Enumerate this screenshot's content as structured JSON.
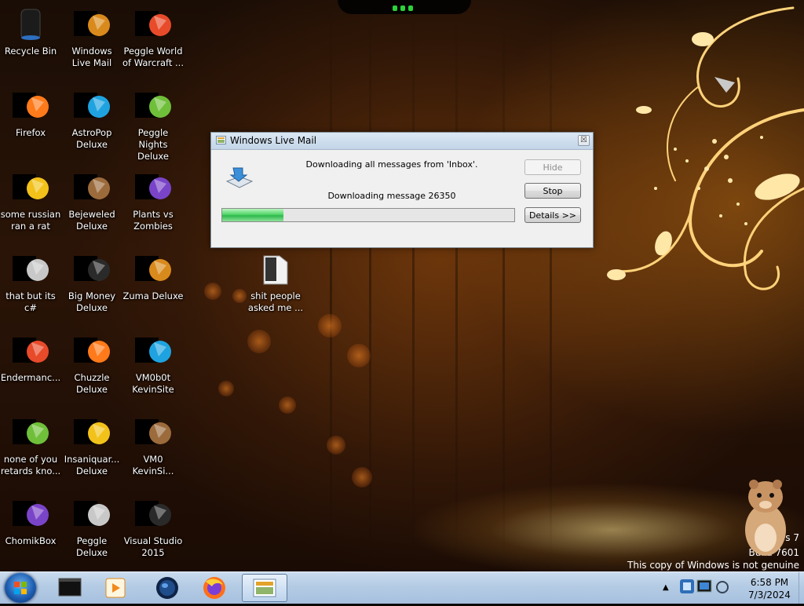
{
  "desktop_icons": [
    {
      "label": "Recycle Bin",
      "icon": "recycle-bin-icon"
    },
    {
      "label": "Windows Live Mail",
      "icon": "mail-icon"
    },
    {
      "label": "Peggle World of Warcraft ...",
      "icon": "peggle-icon"
    },
    {
      "label": "Firefox",
      "icon": "firefox-icon"
    },
    {
      "label": "AstroPop Deluxe",
      "icon": "game-icon"
    },
    {
      "label": "Peggle Nights Deluxe",
      "icon": "peggle-icon"
    },
    {
      "label": "some russian ran a rat",
      "icon": "app-icon"
    },
    {
      "label": "Bejeweled Deluxe",
      "icon": "gem-icon"
    },
    {
      "label": "Plants vs Zombies",
      "icon": "plant-icon"
    },
    {
      "label": "that but its c#",
      "icon": "app-icon"
    },
    {
      "label": "Big Money Deluxe",
      "icon": "game-icon"
    },
    {
      "label": "Zuma Deluxe",
      "icon": "game-icon"
    },
    {
      "label": "Endermanc...",
      "icon": "app-icon"
    },
    {
      "label": "Chuzzle Deluxe",
      "icon": "game-icon"
    },
    {
      "label": "VM0b0t KevinSite",
      "icon": "app-icon"
    },
    {
      "label": "none of you retards kno...",
      "icon": "app-icon"
    },
    {
      "label": "Insaniquar... Deluxe",
      "icon": "fish-icon"
    },
    {
      "label": "VM0 KevinSi...",
      "icon": "file-icon"
    },
    {
      "label": "ChomikBox",
      "icon": "hamster-icon"
    },
    {
      "label": "Peggle Deluxe",
      "icon": "peggle-icon"
    },
    {
      "label": "Visual Studio 2015",
      "icon": "visual-studio-icon"
    },
    {
      "label": "shit people asked me ...",
      "icon": "folder-icon"
    }
  ],
  "dialog": {
    "title": "Windows Live Mail",
    "close_glyph": "☒",
    "status_line": "Downloading all messages from 'Inbox'.",
    "progress_line": "Downloading message 26350",
    "progress_fraction": 0.21,
    "buttons": {
      "hide": "Hide",
      "stop": "Stop",
      "details": "Details >>"
    }
  },
  "taskbar": {
    "pinned": [
      {
        "name": "cmd-icon"
      },
      {
        "name": "media-player-icon"
      },
      {
        "name": "globe-icon"
      },
      {
        "name": "firefox-icon"
      },
      {
        "name": "windows-live-mail-icon",
        "active": true
      }
    ],
    "clock_time": "6:58 PM",
    "clock_date": "7/3/2024",
    "tray_arrow": "▲"
  },
  "watermark": {
    "line1": "vs 7",
    "line2": "Build 7601",
    "line3": "This copy of Windows is not genuine"
  },
  "colors": {
    "progress": "#2eb94c",
    "taskbar": "#b4cbe4",
    "accent_green": "#2bd23a"
  }
}
